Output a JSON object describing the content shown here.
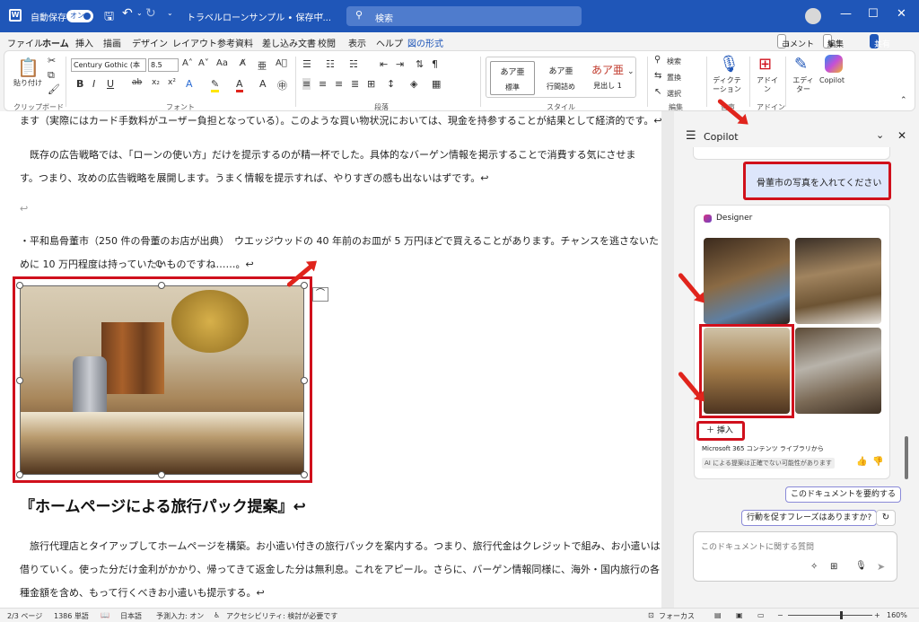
{
  "titlebar": {
    "app_icon": "word-icon",
    "autosave_label": "自動保存",
    "autosave_state": "オン",
    "doc_title": "トラベルローンサンプル • 保存中...",
    "search_placeholder": "検索"
  },
  "menu": {
    "tabs": [
      "ファイル",
      "ホーム",
      "挿入",
      "描画",
      "デザイン",
      "レイアウト",
      "参考資料",
      "差し込み文書",
      "校閲",
      "表示",
      "ヘルプ",
      "図の形式"
    ],
    "active": "ホーム",
    "comment": "コメント",
    "edit": "編集",
    "share": "共有"
  },
  "ribbon": {
    "clipboard": {
      "paste": "貼り付け",
      "group": "クリップボード"
    },
    "font": {
      "name": "Century Gothic (本",
      "size": "8.5",
      "group": "フォント"
    },
    "paragraph": {
      "group": "段落"
    },
    "styles": {
      "items": [
        {
          "sample": "あア亜",
          "label": "標準"
        },
        {
          "sample": "あア亜",
          "label": "行間詰め"
        },
        {
          "sample": "あア亜",
          "label": "見出し 1"
        }
      ],
      "group": "スタイル"
    },
    "editing": {
      "find": "検索",
      "replace": "置換",
      "select": "選択",
      "group": "編集"
    },
    "voice": {
      "dictate": "ディクテーション",
      "group": "音声"
    },
    "addin": {
      "addins": "アドイン",
      "group": "アドイン"
    },
    "editor": "エディター",
    "copilot": "Copilot"
  },
  "document": {
    "para1": "ます（実際にはカード手数料がユーザー負担となっている）。このような買い物状況においては、現金を持参することが結果として経済的です。↩",
    "para2a": "既存の広告戦略では、「ローンの使い方」だけを提示するのが精一杯でした。具体的なバーゲン情報を掲示することで消費する気にさせま",
    "para2b": "す。つまり、攻めの広告戦略を展開します。うまく情報を提示すれば、やりすぎの感も出ないはずです。↩",
    "empty": "↩",
    "para3a": "・平和島骨董市（250 件の骨董のお店が出典）　ウエッジウッドの 40 年前のお皿が 5 万円ほどで買えることがあります。チャンスを逃さないた",
    "para3b": "めに 10 万円程度は持っていたいものですね……。↩",
    "heading": "『ホームページによる旅行パック提案』↩",
    "para4a": "旅行代理店とタイアップしてホームページを構築。お小遣い付きの旅行パックを案内する。つまり、旅行代金はクレジットで組み、お小遣いは",
    "para4b": "借りていく。使った分だけ金利がかかり、帰ってきて返金した分は無利息。これをアピール。さらに、バーゲン情報同様に、海外・国内旅行の各",
    "para4c": "種金額を含め、もって行くべきお小遣いも提示する。↩"
  },
  "copilot": {
    "title": "Copilot",
    "user_message": "骨董市の写真を入れてください",
    "designer": "Designer",
    "insert": "挿入",
    "source": "Microsoft 365 コンテンツ ライブラリから",
    "disclaimer": "AI による提案は正確でない可能性があります",
    "suggestions": [
      "このドキュメントを要約する",
      "行動を促すフレーズはありますか?"
    ],
    "input_placeholder": "このドキュメントに関する質問"
  },
  "status": {
    "page": "2/3 ページ",
    "words": "1386 単語",
    "language": "日本語",
    "predictive": "予測入力: オン",
    "accessibility": "アクセシビリティ: 検討が必要です",
    "focus": "フォーカス",
    "zoom": "160%"
  },
  "colors": {
    "titlebar": "#1f56b8",
    "highlight": "#d0101c",
    "arrow": "#e0241c"
  }
}
